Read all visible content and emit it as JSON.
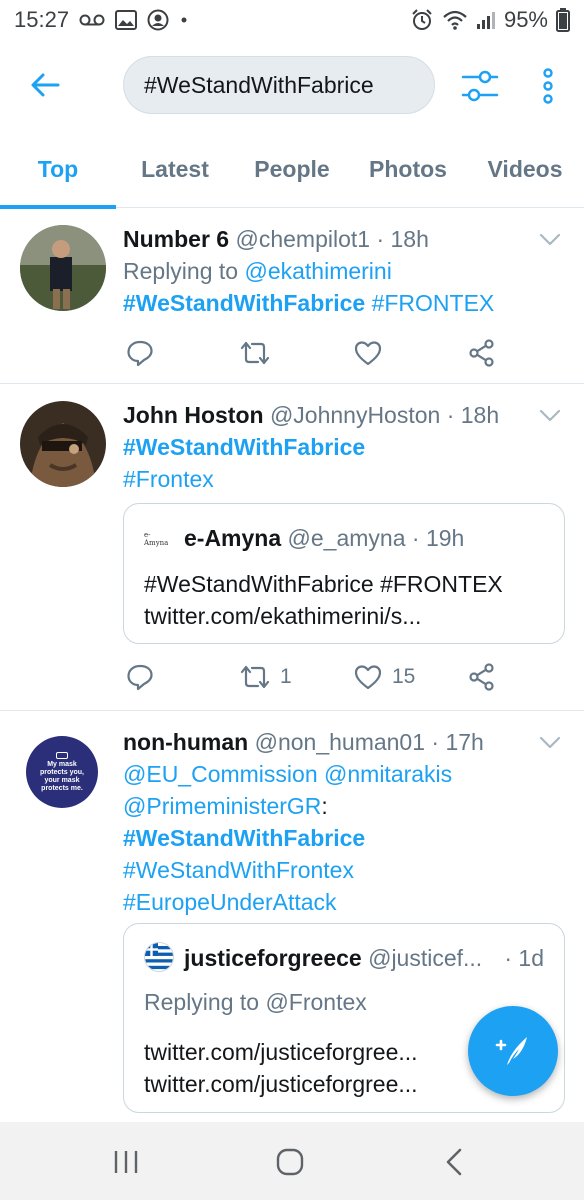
{
  "status_bar": {
    "time": "15:27",
    "battery": "95%"
  },
  "search": {
    "query": "#WeStandWithFabrice"
  },
  "tabs": [
    {
      "label": "Top",
      "active": true
    },
    {
      "label": "Latest",
      "active": false
    },
    {
      "label": "People",
      "active": false
    },
    {
      "label": "Photos",
      "active": false
    },
    {
      "label": "Videos",
      "active": false
    }
  ],
  "tweets": [
    {
      "name": "Number 6",
      "handle": "@chempilot1",
      "time": "· 18h",
      "replying_prefix": "Replying to ",
      "replying_to": "@ekathimerini",
      "hashtag_main": "#WeStandWithFabrice",
      "hashtag_2": "#FRONTEX"
    },
    {
      "name": "John Hoston",
      "handle": "@JohnnyHoston",
      "time": "· 18h",
      "hashtag_main": "#WeStandWithFabrice",
      "hashtag_2": "#Frontex",
      "quote": {
        "avatar_text": "e-Amyna",
        "name": "e-Amyna",
        "handle": "@e_amyna",
        "time": "· 19h",
        "text": "#WeStandWithFabrice #FRONTEX",
        "link": "twitter.com/ekathimerini/s..."
      },
      "retweets": "1",
      "likes": "15"
    },
    {
      "name": "non-human",
      "handle": "@non_human01",
      "time": "· 17h",
      "avatar_text_1": "My mask",
      "avatar_text_2": "protects you,",
      "avatar_text_3": "your mask",
      "avatar_text_4": "protects me.",
      "mention_1": "@EU_Commission",
      "mention_2": "@nmitarakis",
      "mention_3": "@PrimeministerGR",
      "colon": ":",
      "hashtag_main": "#WeStandWithFabrice",
      "hashtag_2": "#WeStandWithFrontex",
      "hashtag_3": "#EuropeUnderAttack",
      "quote": {
        "name": "justiceforgreece",
        "handle": "@justicef...",
        "time": "· 1d",
        "replying": "Replying to @Frontex",
        "link_1": "twitter.com/justiceforgree...",
        "link_2": "twitter.com/justiceforgree..."
      }
    }
  ],
  "colors": {
    "accent": "#1da1f2",
    "text_secondary": "#657786",
    "border": "#e1e8ed"
  },
  "icons": [
    "back-arrow-icon",
    "filter-sliders-icon",
    "more-vertical-icon",
    "reply-icon",
    "retweet-icon",
    "like-icon",
    "share-icon",
    "chevron-down-icon",
    "compose-tweet-icon",
    "recent-apps-icon",
    "home-icon",
    "nav-back-icon"
  ]
}
